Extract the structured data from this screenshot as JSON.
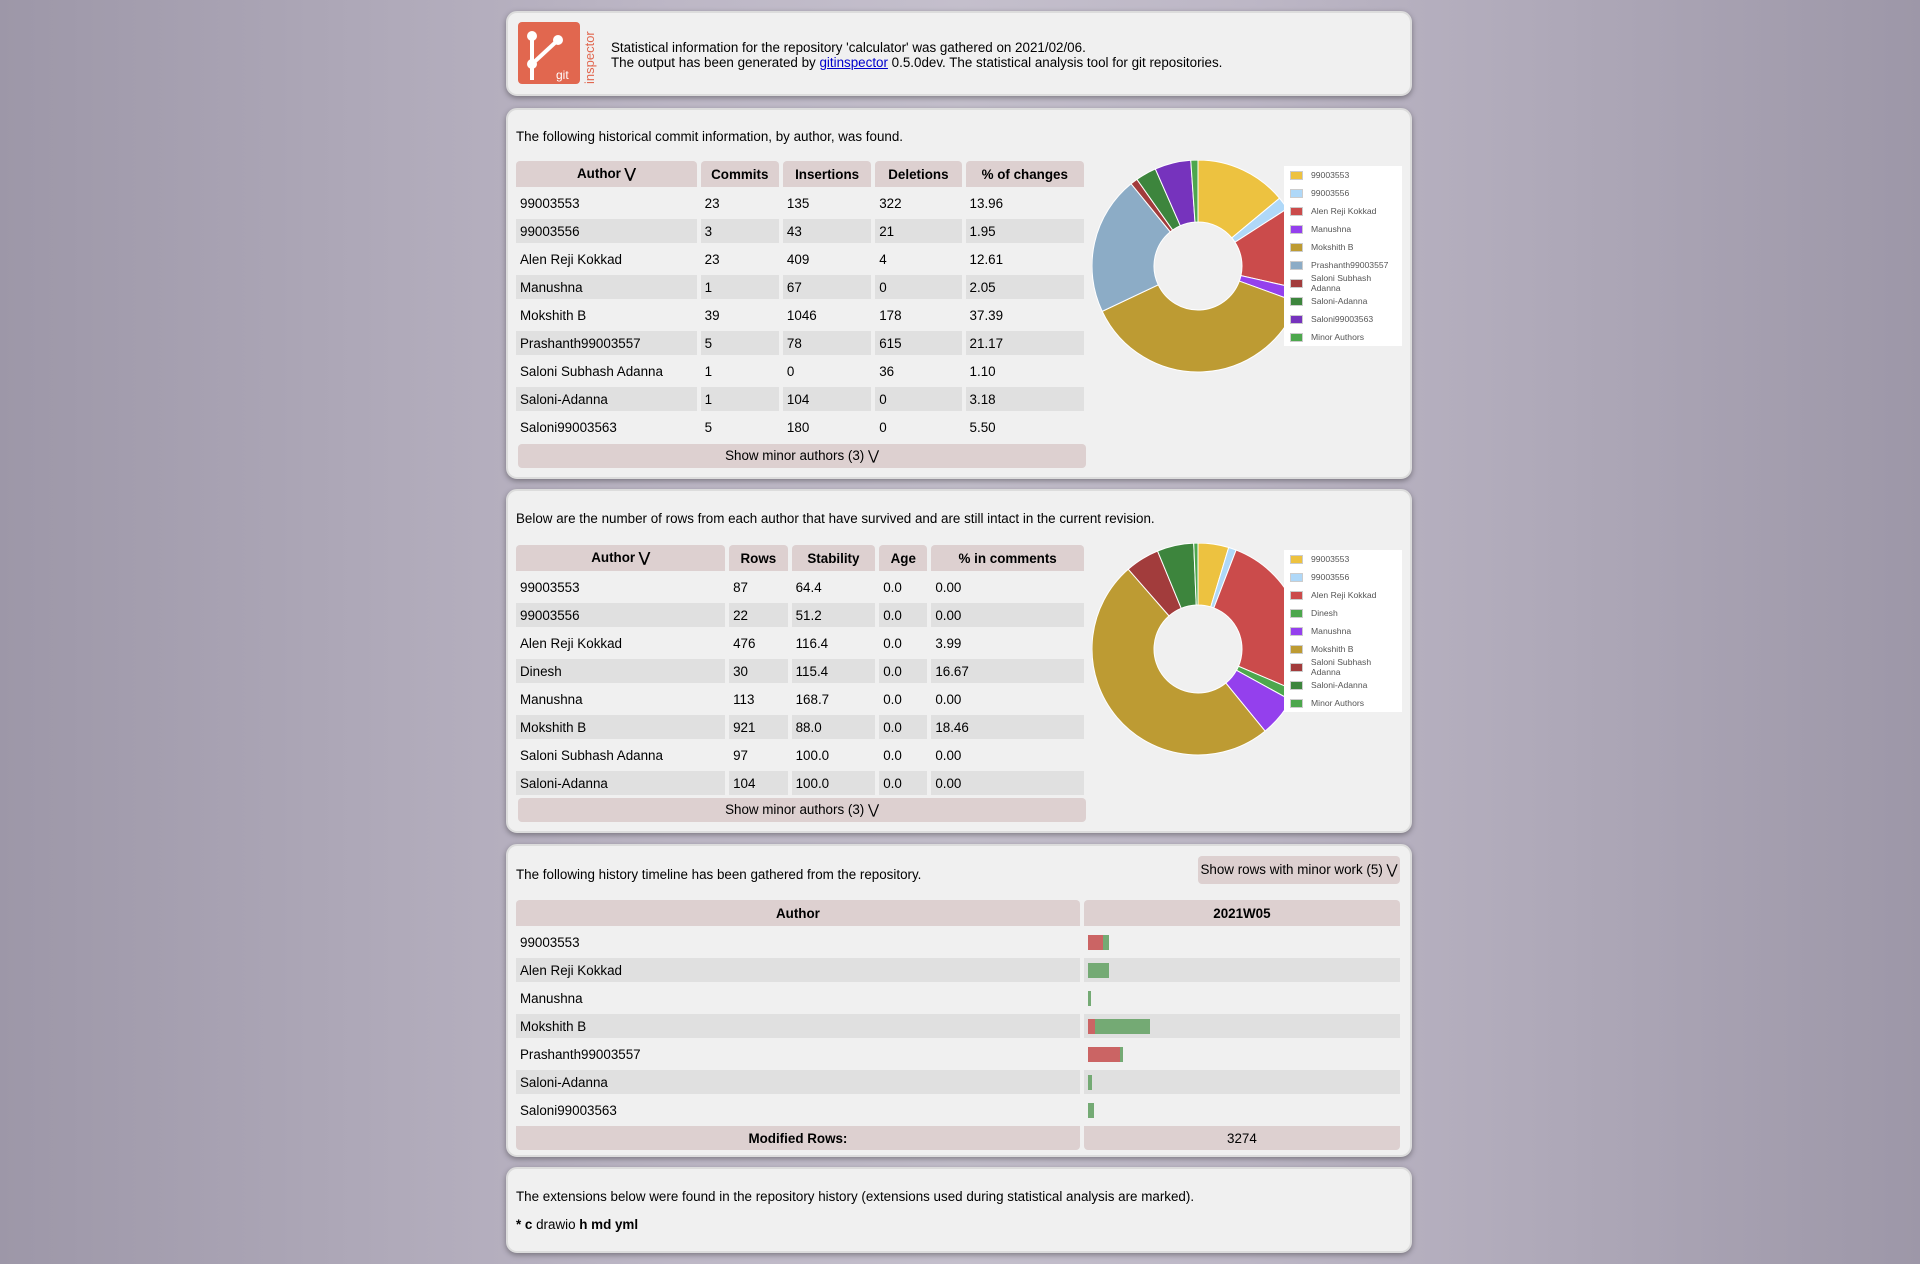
{
  "header": {
    "logo_text": "git",
    "logo_side_text": "inspector",
    "line1": "Statistical information for the repository 'calculator' was gathered on 2021/02/06.",
    "line2_prefix": "The output has been generated by ",
    "line2_link": "gitinspector",
    "line2_suffix": " 0.5.0dev. The statistical analysis tool for git repositories."
  },
  "commits": {
    "intro": "The following historical commit information, by author, was found.",
    "columns": [
      "Author ⋁",
      "Commits",
      "Insertions",
      "Deletions",
      "% of changes"
    ],
    "rows": [
      [
        "99003553",
        "23",
        "135",
        "322",
        "13.96"
      ],
      [
        "99003556",
        "3",
        "43",
        "21",
        "1.95"
      ],
      [
        "Alen Reji Kokkad",
        "23",
        "409",
        "4",
        "12.61"
      ],
      [
        "Manushna",
        "1",
        "67",
        "0",
        "2.05"
      ],
      [
        "Mokshith B",
        "39",
        "1046",
        "178",
        "37.39"
      ],
      [
        "Prashanth99003557",
        "5",
        "78",
        "615",
        "21.17"
      ],
      [
        "Saloni Subhash Adanna",
        "1",
        "0",
        "36",
        "1.10"
      ],
      [
        "Saloni-Adanna",
        "1",
        "104",
        "0",
        "3.18"
      ],
      [
        "Saloni99003563",
        "5",
        "180",
        "0",
        "5.50"
      ]
    ],
    "footer": "Show minor authors (3) ⋁",
    "legend": [
      "99003553",
      "99003556",
      "Alen Reji Kokkad",
      "Manushna",
      "Mokshith B",
      "Prashanth99003557",
      "Saloni Subhash Adanna",
      "Saloni-Adanna",
      "Saloni99003563",
      "Minor Authors"
    ],
    "legend_colors": [
      "#edc240",
      "#afd8f8",
      "#cb4b4b",
      "#9440ed",
      "#bd9b33",
      "#8cacc6",
      "#a23c3c",
      "#3d853d",
      "#7633bd",
      "#4da74d"
    ]
  },
  "blame": {
    "intro": "Below are the number of rows from each author that have survived and are still intact in the current revision.",
    "columns": [
      "Author ⋁",
      "Rows",
      "Stability",
      "Age",
      "% in comments"
    ],
    "rows": [
      [
        "99003553",
        "87",
        "64.4",
        "0.0",
        "0.00"
      ],
      [
        "99003556",
        "22",
        "51.2",
        "0.0",
        "0.00"
      ],
      [
        "Alen Reji Kokkad",
        "476",
        "116.4",
        "0.0",
        "3.99"
      ],
      [
        "Dinesh",
        "30",
        "115.4",
        "0.0",
        "16.67"
      ],
      [
        "Manushna",
        "113",
        "168.7",
        "0.0",
        "0.00"
      ],
      [
        "Mokshith B",
        "921",
        "88.0",
        "0.0",
        "18.46"
      ],
      [
        "Saloni Subhash Adanna",
        "97",
        "100.0",
        "0.0",
        "0.00"
      ],
      [
        "Saloni-Adanna",
        "104",
        "100.0",
        "0.0",
        "0.00"
      ]
    ],
    "footer": "Show minor authors (3) ⋁",
    "legend": [
      "99003553",
      "99003556",
      "Alen Reji Kokkad",
      "Dinesh",
      "Manushna",
      "Mokshith B",
      "Saloni Subhash Adanna",
      "Saloni-Adanna",
      "Minor Authors"
    ],
    "legend_colors": [
      "#edc240",
      "#afd8f8",
      "#cb4b4b",
      "#4da74d",
      "#9440ed",
      "#bd9b33",
      "#a23c3c",
      "#3d853d",
      "#4da74d"
    ]
  },
  "timeline": {
    "intro": "The following history timeline has been gathered from the repository.",
    "minor_button": "Show rows with minor work (5) ⋁",
    "col_author": "Author",
    "col_period": "2021W05",
    "rows": [
      {
        "author": "99003553",
        "removed_frac": 0.05,
        "added_frac": 0.018
      },
      {
        "author": "Alen Reji Kokkad",
        "removed_frac": 0.0,
        "added_frac": 0.07
      },
      {
        "author": "Manushna",
        "removed_frac": 0.0,
        "added_frac": 0.01
      },
      {
        "author": "Mokshith B",
        "removed_frac": 0.022,
        "added_frac": 0.18
      },
      {
        "author": "Prashanth99003557",
        "removed_frac": 0.105,
        "added_frac": 0.011
      },
      {
        "author": "Saloni-Adanna",
        "removed_frac": 0.0,
        "added_frac": 0.012
      },
      {
        "author": "Saloni99003563",
        "removed_frac": 0.0,
        "added_frac": 0.02
      }
    ],
    "footer_label": "Modified Rows:",
    "footer_value": "3274",
    "removed_color": "#cb6464",
    "added_color": "#74aa74"
  },
  "extensions": {
    "intro": "The extensions below were found in the repository history (extensions used during statistical analysis are marked).",
    "list": [
      {
        "text": "* c",
        "bold": true
      },
      {
        "text": " drawio ",
        "bold": false
      },
      {
        "text": "h md yml",
        "bold": true
      }
    ]
  },
  "chart_data": [
    {
      "type": "pie",
      "categories": [
        "99003553",
        "99003556",
        "Alen Reji Kokkad",
        "Manushna",
        "Mokshith B",
        "Prashanth99003557",
        "Saloni Subhash Adanna",
        "Saloni-Adanna",
        "Saloni99003563",
        "Minor Authors"
      ],
      "values": [
        13.96,
        1.95,
        12.61,
        2.05,
        37.39,
        21.17,
        1.1,
        3.18,
        5.5,
        1.09
      ]
    },
    {
      "type": "pie",
      "categories": [
        "99003553",
        "99003556",
        "Alen Reji Kokkad",
        "Dinesh",
        "Manushna",
        "Mokshith B",
        "Saloni Subhash Adanna",
        "Saloni-Adanna",
        "Minor Authors"
      ],
      "values": [
        87,
        22,
        476,
        30,
        113,
        921,
        97,
        104,
        12
      ]
    }
  ]
}
